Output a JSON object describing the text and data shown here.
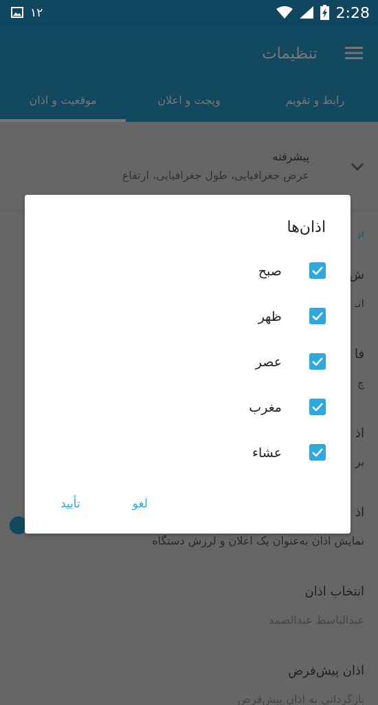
{
  "status_bar": {
    "notification_count": "۱۲",
    "time": "2:28"
  },
  "toolbar": {
    "title": "تنظیمات"
  },
  "tabs": [
    {
      "label": "رابط و تقویم",
      "selected": false
    },
    {
      "label": "ویجت و اعلان",
      "selected": false
    },
    {
      "label": "موقعیت و اذان",
      "selected": true
    }
  ],
  "advanced": {
    "title": "پیشرفته",
    "subtitle": "عرض جغرافیایی، طول جغرافیایی، ارتفاع",
    "expanded": false
  },
  "settings": [
    {
      "kind": "header",
      "title": "اذ"
    },
    {
      "kind": "item",
      "title": "ش",
      "subtitle": "انـ"
    },
    {
      "kind": "item",
      "title": "فا",
      "subtitle": "چ"
    },
    {
      "kind": "item",
      "title": "اذ",
      "subtitle": "بر"
    },
    {
      "kind": "switch",
      "title": "اذ",
      "subtitle": "نمایش اذان به‌عنوان یک اعلان و لرزش دستگاه",
      "on": true
    },
    {
      "kind": "item",
      "title": "انتخاب اذان",
      "subtitle": "عبدالباسط عبدالصمد",
      "faint": true
    },
    {
      "kind": "item",
      "title": "اذان پیش‌فرض",
      "subtitle": "بازگردانی به اذان پیش‌فرض",
      "faint": true
    }
  ],
  "dialog": {
    "title": "اذان‌ها",
    "options": [
      {
        "label": "صبح",
        "checked": true
      },
      {
        "label": "ظهر",
        "checked": true
      },
      {
        "label": "عصر",
        "checked": true
      },
      {
        "label": "مغرب",
        "checked": true
      },
      {
        "label": "عشاء",
        "checked": true
      }
    ],
    "buttons": [
      "لغو",
      "تأیید"
    ]
  }
}
